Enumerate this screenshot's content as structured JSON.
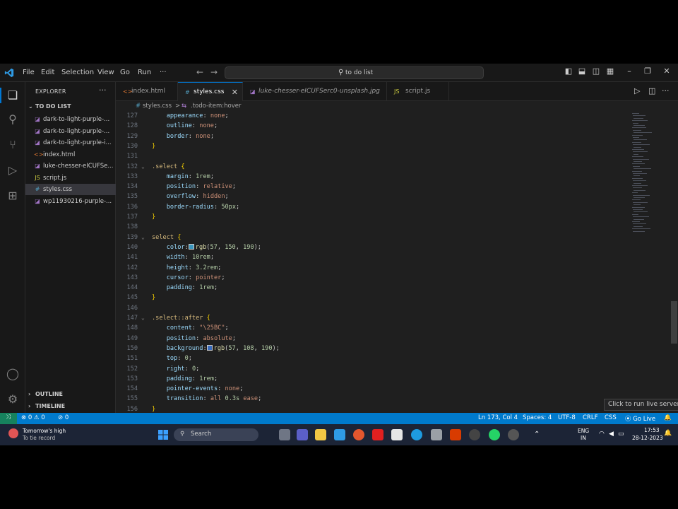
{
  "menu": [
    "File",
    "Edit",
    "Selection",
    "View",
    "Go",
    "Run",
    "···"
  ],
  "command_center": "to do list",
  "sidebar": {
    "title": "EXPLORER",
    "folder": "TO DO LIST",
    "files": [
      {
        "name": "dark-to-light-purple-...",
        "icon": "image-icon",
        "active": false
      },
      {
        "name": "dark-to-light-purple-...",
        "icon": "image-icon",
        "active": false
      },
      {
        "name": "dark-to-light-purple-i...",
        "icon": "image-icon",
        "active": false
      },
      {
        "name": "index.html",
        "icon": "html-icon",
        "active": false
      },
      {
        "name": "luke-chesser-eICUFSe...",
        "icon": "image-icon",
        "active": false
      },
      {
        "name": "script.js",
        "icon": "js-icon",
        "active": false
      },
      {
        "name": "styles.css",
        "icon": "css-icon",
        "active": true
      },
      {
        "name": "wp11930216-purple-...",
        "icon": "image-icon",
        "active": false
      }
    ],
    "outline": "OUTLINE",
    "timeline": "TIMELINE"
  },
  "tabs": [
    {
      "label": "index.html",
      "icon": "html-icon",
      "active": false
    },
    {
      "label": "styles.css",
      "icon": "css-icon",
      "active": true
    },
    {
      "label": "luke-chesser-eICUFSerc0-unsplash.jpg",
      "icon": "image-icon",
      "active": false
    },
    {
      "label": "script.js",
      "icon": "js-icon",
      "active": false
    }
  ],
  "breadcrumb": [
    "styles.css",
    ">",
    ".todo-item:hover"
  ],
  "code_lines": [
    {
      "n": "127",
      "fold": "",
      "parts": [
        [
          "    ",
          "plain"
        ],
        [
          "appearance",
          "prop"
        ],
        [
          ": ",
          "plain"
        ],
        [
          "none",
          "val"
        ],
        [
          ";",
          "plain"
        ]
      ]
    },
    {
      "n": "128",
      "fold": "",
      "parts": [
        [
          "    ",
          "plain"
        ],
        [
          "outline",
          "prop"
        ],
        [
          ": ",
          "plain"
        ],
        [
          "none",
          "val"
        ],
        [
          ";",
          "plain"
        ]
      ]
    },
    {
      "n": "129",
      "fold": "",
      "parts": [
        [
          "    ",
          "plain"
        ],
        [
          "border",
          "prop"
        ],
        [
          ": ",
          "plain"
        ],
        [
          "none",
          "val"
        ],
        [
          ";",
          "plain"
        ]
      ]
    },
    {
      "n": "130",
      "fold": "",
      "parts": [
        [
          "}",
          "brace"
        ]
      ]
    },
    {
      "n": "131",
      "fold": "",
      "parts": []
    },
    {
      "n": "132",
      "fold": "⌄",
      "parts": [
        [
          ".select",
          "sel"
        ],
        [
          " ",
          "plain"
        ],
        [
          "{",
          "brace"
        ]
      ]
    },
    {
      "n": "133",
      "fold": "",
      "parts": [
        [
          "    ",
          "plain"
        ],
        [
          "margin",
          "prop"
        ],
        [
          ": ",
          "plain"
        ],
        [
          "1rem",
          "num"
        ],
        [
          ";",
          "plain"
        ]
      ]
    },
    {
      "n": "134",
      "fold": "",
      "parts": [
        [
          "    ",
          "plain"
        ],
        [
          "position",
          "prop"
        ],
        [
          ": ",
          "plain"
        ],
        [
          "relative",
          "val"
        ],
        [
          ";",
          "plain"
        ]
      ]
    },
    {
      "n": "135",
      "fold": "",
      "parts": [
        [
          "    ",
          "plain"
        ],
        [
          "overflow",
          "prop"
        ],
        [
          ": ",
          "plain"
        ],
        [
          "hidden",
          "val"
        ],
        [
          ";",
          "plain"
        ]
      ]
    },
    {
      "n": "136",
      "fold": "",
      "parts": [
        [
          "    ",
          "plain"
        ],
        [
          "border-radius",
          "prop"
        ],
        [
          ": ",
          "plain"
        ],
        [
          "50px",
          "num"
        ],
        [
          ";",
          "plain"
        ]
      ]
    },
    {
      "n": "137",
      "fold": "",
      "parts": [
        [
          "}",
          "brace"
        ]
      ]
    },
    {
      "n": "138",
      "fold": "",
      "parts": []
    },
    {
      "n": "139",
      "fold": "⌄",
      "parts": [
        [
          "select",
          "sel"
        ],
        [
          " ",
          "plain"
        ],
        [
          "{",
          "brace"
        ]
      ]
    },
    {
      "n": "140",
      "fold": "",
      "parts": [
        [
          "    ",
          "plain"
        ],
        [
          "color",
          "prop"
        ],
        [
          ":",
          "plain"
        ],
        [
          "#3996be",
          "swatch"
        ],
        [
          "rgb",
          "fn"
        ],
        [
          "(",
          "plain"
        ],
        [
          "57",
          "num"
        ],
        [
          ", ",
          "plain"
        ],
        [
          "150",
          "num"
        ],
        [
          ", ",
          "plain"
        ],
        [
          "190",
          "num"
        ],
        [
          ");",
          "plain"
        ]
      ]
    },
    {
      "n": "141",
      "fold": "",
      "parts": [
        [
          "    ",
          "plain"
        ],
        [
          "width",
          "prop"
        ],
        [
          ": ",
          "plain"
        ],
        [
          "10rem",
          "num"
        ],
        [
          ";",
          "plain"
        ]
      ]
    },
    {
      "n": "142",
      "fold": "",
      "parts": [
        [
          "    ",
          "plain"
        ],
        [
          "height",
          "prop"
        ],
        [
          ": ",
          "plain"
        ],
        [
          "3.2rem",
          "num"
        ],
        [
          ";",
          "plain"
        ]
      ]
    },
    {
      "n": "143",
      "fold": "",
      "parts": [
        [
          "    ",
          "plain"
        ],
        [
          "cursor",
          "prop"
        ],
        [
          ": ",
          "plain"
        ],
        [
          "pointer",
          "val"
        ],
        [
          ";",
          "plain"
        ]
      ]
    },
    {
      "n": "144",
      "fold": "",
      "parts": [
        [
          "    ",
          "plain"
        ],
        [
          "padding",
          "prop"
        ],
        [
          ": ",
          "plain"
        ],
        [
          "1rem",
          "num"
        ],
        [
          ";",
          "plain"
        ]
      ]
    },
    {
      "n": "145",
      "fold": "",
      "parts": [
        [
          "}",
          "brace"
        ]
      ]
    },
    {
      "n": "146",
      "fold": "",
      "parts": []
    },
    {
      "n": "147",
      "fold": "⌄",
      "parts": [
        [
          ".select::after",
          "sel"
        ],
        [
          " ",
          "plain"
        ],
        [
          "{",
          "brace"
        ]
      ]
    },
    {
      "n": "148",
      "fold": "",
      "parts": [
        [
          "    ",
          "plain"
        ],
        [
          "content",
          "prop"
        ],
        [
          ": ",
          "plain"
        ],
        [
          "\"\\25BC\"",
          "val"
        ],
        [
          ";",
          "plain"
        ]
      ]
    },
    {
      "n": "149",
      "fold": "",
      "parts": [
        [
          "    ",
          "plain"
        ],
        [
          "position",
          "prop"
        ],
        [
          ": ",
          "plain"
        ],
        [
          "absolute",
          "val"
        ],
        [
          ";",
          "plain"
        ]
      ]
    },
    {
      "n": "150",
      "fold": "",
      "parts": [
        [
          "    ",
          "plain"
        ],
        [
          "background",
          "prop"
        ],
        [
          ":",
          "plain"
        ],
        [
          "#396cbe",
          "swatch"
        ],
        [
          "rgb",
          "fn"
        ],
        [
          "(",
          "plain"
        ],
        [
          "57",
          "num"
        ],
        [
          ", ",
          "plain"
        ],
        [
          "108",
          "num"
        ],
        [
          ", ",
          "plain"
        ],
        [
          "190",
          "num"
        ],
        [
          ");",
          "plain"
        ]
      ]
    },
    {
      "n": "151",
      "fold": "",
      "parts": [
        [
          "    ",
          "plain"
        ],
        [
          "top",
          "prop"
        ],
        [
          ": ",
          "plain"
        ],
        [
          "0",
          "num"
        ],
        [
          ";",
          "plain"
        ]
      ]
    },
    {
      "n": "152",
      "fold": "",
      "parts": [
        [
          "    ",
          "plain"
        ],
        [
          "right",
          "prop"
        ],
        [
          ": ",
          "plain"
        ],
        [
          "0",
          "num"
        ],
        [
          ";",
          "plain"
        ]
      ]
    },
    {
      "n": "153",
      "fold": "",
      "parts": [
        [
          "    ",
          "plain"
        ],
        [
          "padding",
          "prop"
        ],
        [
          ": ",
          "plain"
        ],
        [
          "1rem",
          "num"
        ],
        [
          ";",
          "plain"
        ]
      ]
    },
    {
      "n": "154",
      "fold": "",
      "parts": [
        [
          "    ",
          "plain"
        ],
        [
          "pointer-events",
          "prop"
        ],
        [
          ": ",
          "plain"
        ],
        [
          "none",
          "val"
        ],
        [
          ";",
          "plain"
        ]
      ]
    },
    {
      "n": "155",
      "fold": "",
      "parts": [
        [
          "    ",
          "plain"
        ],
        [
          "transition",
          "prop"
        ],
        [
          ": ",
          "plain"
        ],
        [
          "all ",
          "val"
        ],
        [
          "0.3s",
          "num"
        ],
        [
          " ease",
          "val"
        ],
        [
          ";",
          "plain"
        ]
      ]
    },
    {
      "n": "156",
      "fold": "",
      "parts": [
        [
          "}",
          "brace"
        ]
      ]
    }
  ],
  "tooltip": "Click to run live server",
  "status": {
    "problems": "⊗ 0 ⚠ 0",
    "ports": "⊘ 0",
    "position": "Ln 173, Col 4",
    "spaces": "Spaces: 4",
    "encoding": "UTF-8",
    "eol": "CRLF",
    "language": "CSS",
    "golive": "⦿ Go Live",
    "bell": "🔔"
  },
  "taskbar": {
    "notification_title": "Tomorrow's high",
    "notification_sub": "To tie record",
    "search": "Search",
    "lang": "ENG",
    "region": "IN",
    "time": "17:53",
    "date": "28-12-2023"
  },
  "colors": {
    "accent": "#0078d4",
    "statusbar": "#007acc",
    "remote": "#16825d"
  }
}
